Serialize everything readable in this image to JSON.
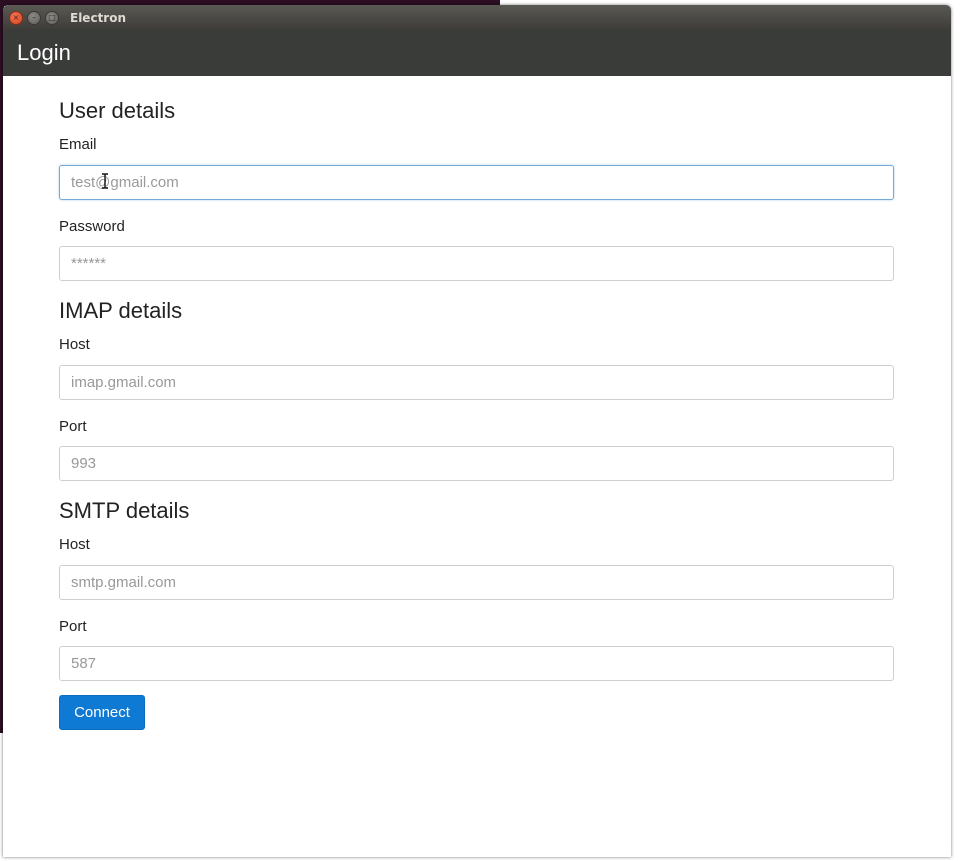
{
  "window": {
    "title": "Electron",
    "close_glyph": "×",
    "min_glyph": "–",
    "max_glyph": "□"
  },
  "appbar": {
    "title": "Login"
  },
  "sections": {
    "user": {
      "title": "User details",
      "email_label": "Email",
      "email_placeholder": "test@gmail.com",
      "password_label": "Password",
      "password_placeholder": "******"
    },
    "imap": {
      "title": "IMAP details",
      "host_label": "Host",
      "host_placeholder": "imap.gmail.com",
      "port_label": "Port",
      "port_placeholder": "993"
    },
    "smtp": {
      "title": "SMTP details",
      "host_label": "Host",
      "host_placeholder": "smtp.gmail.com",
      "port_label": "Port",
      "port_placeholder": "587"
    }
  },
  "actions": {
    "connect_label": "Connect"
  },
  "colors": {
    "appbar": "#3a3c3a",
    "primary_button": "#0f7ad4",
    "focus_border": "#74a9d8"
  },
  "icons": {
    "cursor": "text-cursor-icon"
  }
}
